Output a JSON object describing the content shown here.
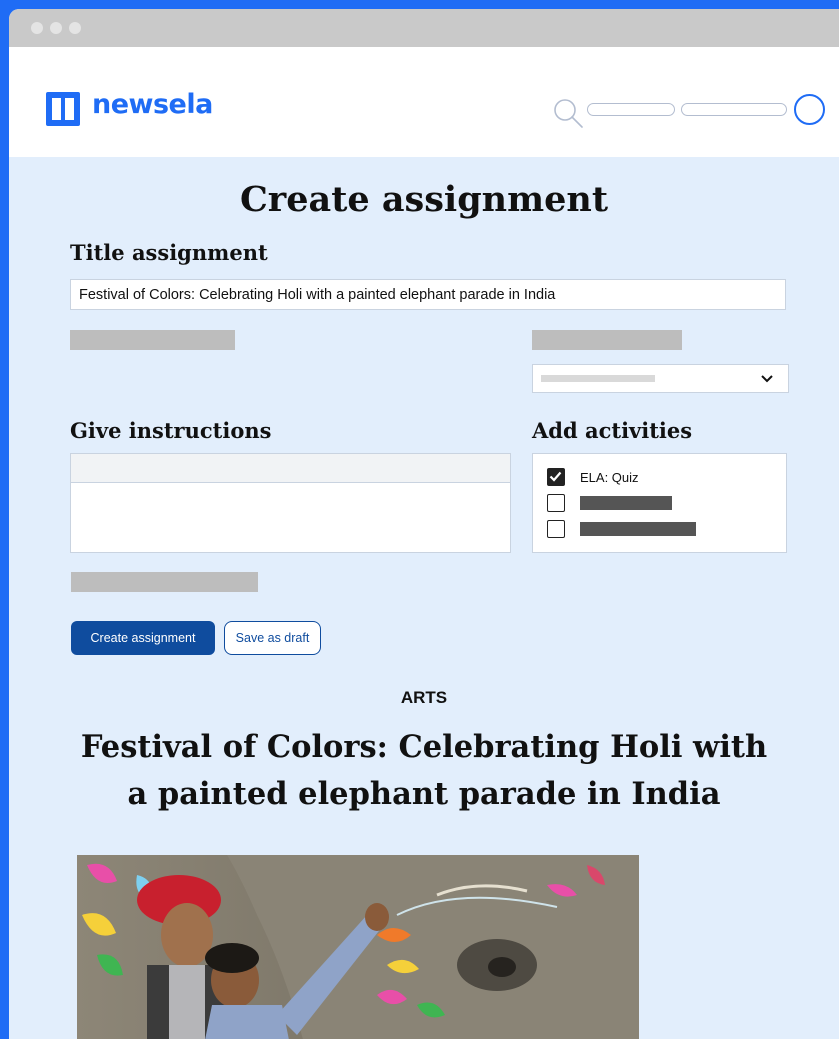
{
  "brand": {
    "name": "newsela",
    "color": "#1f6cf5"
  },
  "page": {
    "title": "Create assignment"
  },
  "form": {
    "title_label": "Title assignment",
    "title_value": "Festival of Colors: Celebrating Holi with a painted elephant parade in India",
    "instructions_label": "Give instructions",
    "activities_label": "Add activities",
    "activities": [
      {
        "label": "ELA: Quiz",
        "checked": true
      },
      {
        "label": "",
        "checked": false
      },
      {
        "label": "",
        "checked": false
      }
    ],
    "create_button": "Create assignment",
    "draft_button": "Save as draft"
  },
  "article": {
    "category": "ARTS",
    "title_line1": "Festival of Colors: Celebrating Holi with",
    "title_line2": "a painted elephant parade in India"
  },
  "icons": {
    "search": "search-icon",
    "dropdown": "chevron-down-icon",
    "check": "check-icon"
  },
  "colors": {
    "primary_button": "#0f4c9e",
    "page_background": "#e2eefc"
  }
}
